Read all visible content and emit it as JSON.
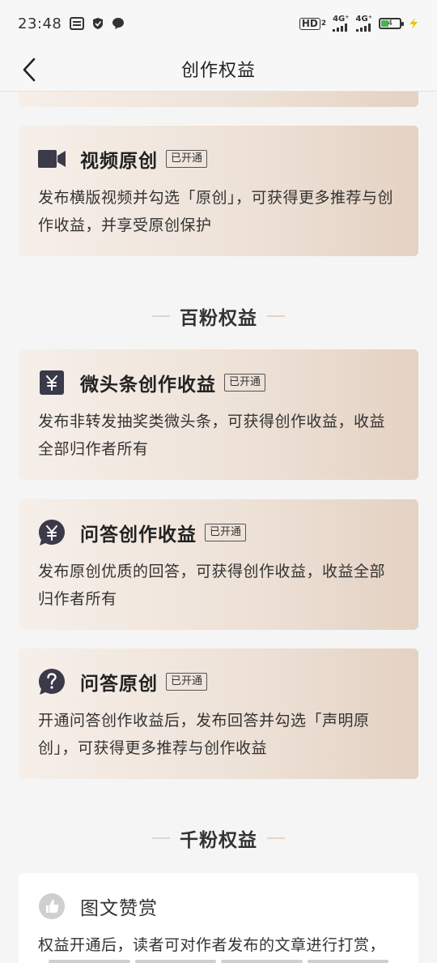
{
  "status_bar": {
    "time": "23:48",
    "network1": "4G⁺",
    "network2": "4G⁺",
    "hd_label": "HD",
    "hd_sub": "2",
    "battery": "4",
    "battery_level": 0.4,
    "icons": [
      "toutiao-icon",
      "shield-icon",
      "message-icon",
      "hd-icon",
      "signal-icon",
      "battery-icon",
      "charging-icon"
    ]
  },
  "nav": {
    "title": "创作权益",
    "back_icon": "chevron-left-icon"
  },
  "cards_top": [
    {
      "icon": "video-camera-icon",
      "title": "视频原创",
      "badge": "已开通",
      "desc": "发布横版视频并勾选「原创」，可获得更多推荐与创作收益，并享受原创保护"
    }
  ],
  "sections": [
    {
      "title": "百粉权益",
      "cards": [
        {
          "icon": "yen-square-icon",
          "title": "微头条创作收益",
          "badge": "已开通",
          "desc": "发布非转发抽奖类微头条，可获得创作收益，收益全部归作者所有"
        },
        {
          "icon": "yen-bubble-icon",
          "title": "问答创作收益",
          "badge": "已开通",
          "desc": "发布原创优质的回答，可获得创作收益，收益全部归作者所有"
        },
        {
          "icon": "question-bubble-icon",
          "title": "问答原创",
          "badge": "已开通",
          "desc": "开通问答创作收益后，发布回答并勾选「声明原创」，可获得更多推荐与创作收益"
        }
      ]
    },
    {
      "title": "千粉权益",
      "cards": [
        {
          "icon": "thumbs-up-icon",
          "title": "图文赞赏",
          "desc": "权益开通后，读者可对作者发布的文章进行打赏，"
        }
      ]
    }
  ],
  "colors": {
    "card_gradient_start": "#f6efe9",
    "card_gradient_end": "#e4d2c3",
    "icon_dark": "#3a3a4a",
    "background": "#f5f5f5"
  }
}
